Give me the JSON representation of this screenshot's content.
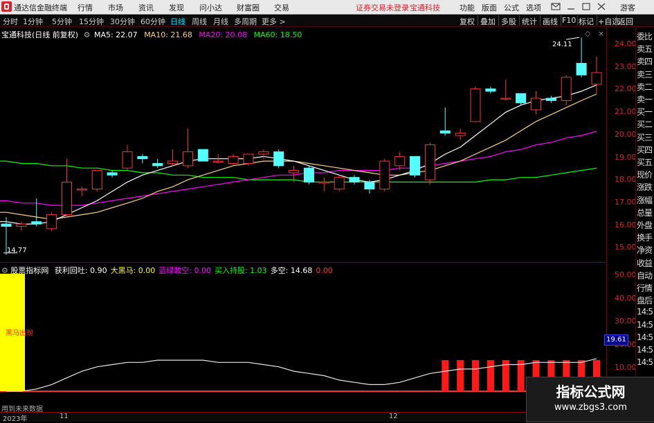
{
  "menubar": {
    "app_title": "通达信金融终端",
    "menus": [
      "行情",
      "市场",
      "资讯",
      "发现",
      "问小达",
      "财富圈",
      "交易"
    ],
    "notice": "证券交易未登录",
    "stock_name_top": "宝通科技",
    "right_menus": [
      "功能",
      "版面",
      "公式",
      "选项"
    ],
    "guest": "游客"
  },
  "toolbar": {
    "timeframes": [
      "分时",
      "1分钟",
      "5分钟",
      "15分钟",
      "30分钟",
      "60分钟",
      "日线",
      "周线",
      "月线",
      "多周期",
      "更多 >"
    ],
    "active_timeframe": "日线",
    "right_buttons": [
      "复权",
      "叠加",
      "多股",
      "统计",
      "画线",
      "F10",
      "标记",
      "+自选",
      "返回"
    ]
  },
  "info_line": {
    "stock": "宝通科技(日线 前复权)",
    "ma5": "MA5: 22.07",
    "ma10": "MA10: 21.68",
    "ma20": "MA20: 20.08",
    "ma60": "MA60: 18.50"
  },
  "indicator_line": {
    "name": "股票指标网",
    "items": [
      {
        "label": "获利回吐: 0.90",
        "color": "#ffffff"
      },
      {
        "label": "大黑马: 0.00",
        "color": "#ffff00"
      },
      {
        "label": "蓝绿敢空: 0.00",
        "color": "#ff00ff"
      },
      {
        "label": "买入持股: 1.03",
        "color": "#00ff00"
      },
      {
        "label": "多空: 14.68",
        "color": "#ffffff"
      },
      {
        "label": "0.00",
        "color": "#ff3333"
      }
    ]
  },
  "price_axis": [
    "24.00",
    "23.00",
    "22.00",
    "21.00",
    "20.00",
    "19.00",
    "18.00",
    "17.00",
    "16.00",
    "15.00"
  ],
  "ind_axis": [
    "50.00",
    "40.00",
    "30.00",
    "20.00",
    "10.00"
  ],
  "annotations": {
    "high": "24.11",
    "low": "14.77",
    "yellow_label": "黑马出现",
    "bottom_left": "用到未来数据",
    "ind_value_box": "19.61"
  },
  "right_panel": [
    "委比",
    "卖五",
    "卖四",
    "卖三",
    "卖二",
    "卖一",
    "买一",
    "买二",
    "买三",
    "买四",
    "买五",
    "现价",
    "涨跌",
    "涨幅",
    "总量",
    "外盘",
    "换手",
    "净资",
    "收益",
    "自动",
    "行情",
    "盘后",
    "14:5",
    "14:5",
    "14:5",
    "14:5",
    "14:5"
  ],
  "date_axis": {
    "year": "2023年",
    "m11": "11",
    "m12": "12"
  },
  "watermark": {
    "title": "指标公式网",
    "url": "www.zbgs3.com"
  },
  "colors": {
    "up": "#ff3333",
    "down": "#54ffff",
    "ma5": "#ffffff",
    "ma10": "#ffd27f",
    "ma20": "#ff00ff",
    "ma60": "#00ff00"
  },
  "chart_data": {
    "type": "candlestick",
    "price_range": [
      14.5,
      24.5
    ],
    "candles": [
      {
        "o": 16.1,
        "h": 16.4,
        "l": 14.77,
        "c": 16.0
      },
      {
        "o": 16.0,
        "h": 16.2,
        "l": 15.8,
        "c": 16.1
      },
      {
        "o": 16.2,
        "h": 17.2,
        "l": 16.0,
        "c": 16.1
      },
      {
        "o": 15.9,
        "h": 16.6,
        "l": 15.8,
        "c": 16.5
      },
      {
        "o": 16.5,
        "h": 18.9,
        "l": 16.4,
        "c": 17.9
      },
      {
        "o": 17.6,
        "h": 17.7,
        "l": 17.3,
        "c": 17.6
      },
      {
        "o": 17.6,
        "h": 18.3,
        "l": 17.5,
        "c": 18.4
      },
      {
        "o": 18.3,
        "h": 18.4,
        "l": 18.1,
        "c": 18.2
      },
      {
        "o": 18.5,
        "h": 19.5,
        "l": 18.4,
        "c": 19.2
      },
      {
        "o": 19.0,
        "h": 19.1,
        "l": 18.7,
        "c": 18.9
      },
      {
        "o": 18.7,
        "h": 18.9,
        "l": 18.5,
        "c": 18.6
      },
      {
        "o": 18.7,
        "h": 19.3,
        "l": 18.6,
        "c": 18.8
      },
      {
        "o": 18.6,
        "h": 20.2,
        "l": 18.5,
        "c": 19.2
      },
      {
        "o": 19.3,
        "h": 19.3,
        "l": 18.8,
        "c": 18.8
      },
      {
        "o": 18.8,
        "h": 19.1,
        "l": 18.7,
        "c": 18.8
      },
      {
        "o": 18.7,
        "h": 19.1,
        "l": 18.6,
        "c": 19.0
      },
      {
        "o": 18.7,
        "h": 19.1,
        "l": 18.6,
        "c": 19.1
      },
      {
        "o": 19.1,
        "h": 19.3,
        "l": 18.9,
        "c": 19.2
      },
      {
        "o": 19.2,
        "h": 19.3,
        "l": 18.5,
        "c": 18.6
      },
      {
        "o": 18.3,
        "h": 18.6,
        "l": 17.9,
        "c": 18.4
      },
      {
        "o": 18.5,
        "h": 18.6,
        "l": 17.8,
        "c": 17.9
      },
      {
        "o": 17.9,
        "h": 18.1,
        "l": 17.5,
        "c": 17.9
      },
      {
        "o": 17.6,
        "h": 18.2,
        "l": 17.5,
        "c": 18.1
      },
      {
        "o": 18.1,
        "h": 18.2,
        "l": 17.8,
        "c": 17.9
      },
      {
        "o": 17.9,
        "h": 18.0,
        "l": 17.4,
        "c": 17.6
      },
      {
        "o": 17.6,
        "h": 18.9,
        "l": 17.5,
        "c": 18.8
      },
      {
        "o": 18.6,
        "h": 19.2,
        "l": 18.4,
        "c": 19.0
      },
      {
        "o": 19.0,
        "h": 19.0,
        "l": 18.1,
        "c": 18.2
      },
      {
        "o": 18.0,
        "h": 19.6,
        "l": 17.8,
        "c": 19.5
      },
      {
        "o": 20.1,
        "h": 21.1,
        "l": 19.9,
        "c": 20.0
      },
      {
        "o": 19.9,
        "h": 20.2,
        "l": 19.7,
        "c": 20.0
      },
      {
        "o": 20.5,
        "h": 22.0,
        "l": 20.5,
        "c": 21.9
      },
      {
        "o": 21.9,
        "h": 22.0,
        "l": 21.7,
        "c": 21.8
      },
      {
        "o": 21.5,
        "h": 22.3,
        "l": 21.4,
        "c": 21.5
      },
      {
        "o": 21.7,
        "h": 21.7,
        "l": 21.2,
        "c": 21.3
      },
      {
        "o": 21.0,
        "h": 21.8,
        "l": 20.8,
        "c": 21.5
      },
      {
        "o": 21.5,
        "h": 21.6,
        "l": 21.3,
        "c": 21.4
      },
      {
        "o": 21.4,
        "h": 22.5,
        "l": 21.2,
        "c": 22.4
      },
      {
        "o": 23.0,
        "h": 24.11,
        "l": 22.4,
        "c": 22.5
      },
      {
        "o": 22.1,
        "h": 23.3,
        "l": 21.7,
        "c": 22.6
      }
    ],
    "ma5": [
      16.2,
      16.1,
      16.1,
      16.2,
      16.5,
      16.8,
      17.1,
      17.5,
      17.9,
      18.2,
      18.4,
      18.6,
      18.8,
      18.9,
      18.9,
      18.9,
      18.9,
      19.0,
      18.9,
      18.8,
      18.6,
      18.4,
      18.2,
      18.0,
      17.9,
      18.0,
      18.2,
      18.4,
      18.7,
      19.1,
      19.4,
      19.9,
      20.4,
      20.9,
      21.2,
      21.4,
      21.5,
      21.6,
      21.8,
      22.07
    ],
    "ma10": [
      16.6,
      16.5,
      16.4,
      16.3,
      16.4,
      16.5,
      16.6,
      16.8,
      17.0,
      17.2,
      17.5,
      17.7,
      18.0,
      18.2,
      18.4,
      18.6,
      18.7,
      18.8,
      18.8,
      18.8,
      18.7,
      18.6,
      18.5,
      18.4,
      18.3,
      18.2,
      18.2,
      18.3,
      18.4,
      18.6,
      18.8,
      19.1,
      19.4,
      19.7,
      20.1,
      20.5,
      20.8,
      21.1,
      21.4,
      21.68
    ],
    "ma20": [
      17.1,
      17.0,
      17.0,
      16.9,
      16.9,
      16.9,
      17.0,
      17.1,
      17.2,
      17.3,
      17.4,
      17.5,
      17.6,
      17.7,
      17.8,
      17.9,
      18.0,
      18.1,
      18.2,
      18.2,
      18.3,
      18.3,
      18.4,
      18.4,
      18.4,
      18.4,
      18.5,
      18.5,
      18.6,
      18.7,
      18.8,
      18.9,
      19.0,
      19.2,
      19.3,
      19.5,
      19.6,
      19.8,
      19.9,
      20.08
    ],
    "ma60": [
      18.8,
      18.7,
      18.7,
      18.6,
      18.6,
      18.5,
      18.5,
      18.4,
      18.4,
      18.3,
      18.3,
      18.2,
      18.2,
      18.1,
      18.1,
      18.1,
      18.0,
      18.0,
      18.0,
      18.0,
      17.9,
      17.9,
      17.9,
      17.9,
      17.9,
      17.9,
      17.9,
      17.9,
      17.9,
      17.9,
      17.9,
      17.9,
      18.0,
      18.0,
      18.1,
      18.1,
      18.2,
      18.3,
      18.4,
      18.5
    ],
    "ind_range": [
      0,
      57
    ],
    "ind_line": [
      0,
      0,
      1,
      3,
      6,
      9,
      11,
      12,
      13,
      13,
      14,
      14,
      14,
      14,
      13,
      13,
      13,
      12,
      11,
      9,
      8,
      7,
      5,
      4,
      3,
      3,
      4,
      6,
      8,
      9,
      10,
      10,
      11,
      12,
      12,
      13,
      13,
      13,
      13,
      14.68
    ],
    "ind_bars_from": 29,
    "ind_bar_value": 14
  }
}
